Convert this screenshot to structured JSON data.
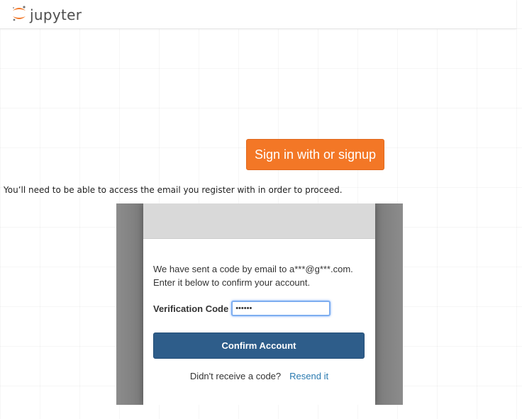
{
  "header": {
    "logo_text": "jupyter",
    "logo_icon": "jupyter-logo-icon"
  },
  "main": {
    "signin_button_label": "Sign in with or signup",
    "note": "You’ll need to be able to access the email you register with in order to proceed."
  },
  "embedded_dialog": {
    "message_line1": "We have sent a code by email to a***@g***.com.",
    "message_line2": "Enter it below to confirm your account.",
    "code_label": "Verification Code",
    "code_value": "••••••",
    "confirm_label": "Confirm Account",
    "resend_prompt": "Didn't receive a code?",
    "resend_link": "Resend it"
  },
  "colors": {
    "accent_orange": "#f37726",
    "confirm_blue": "#2e5d8a",
    "link_blue": "#2a7ab0"
  }
}
